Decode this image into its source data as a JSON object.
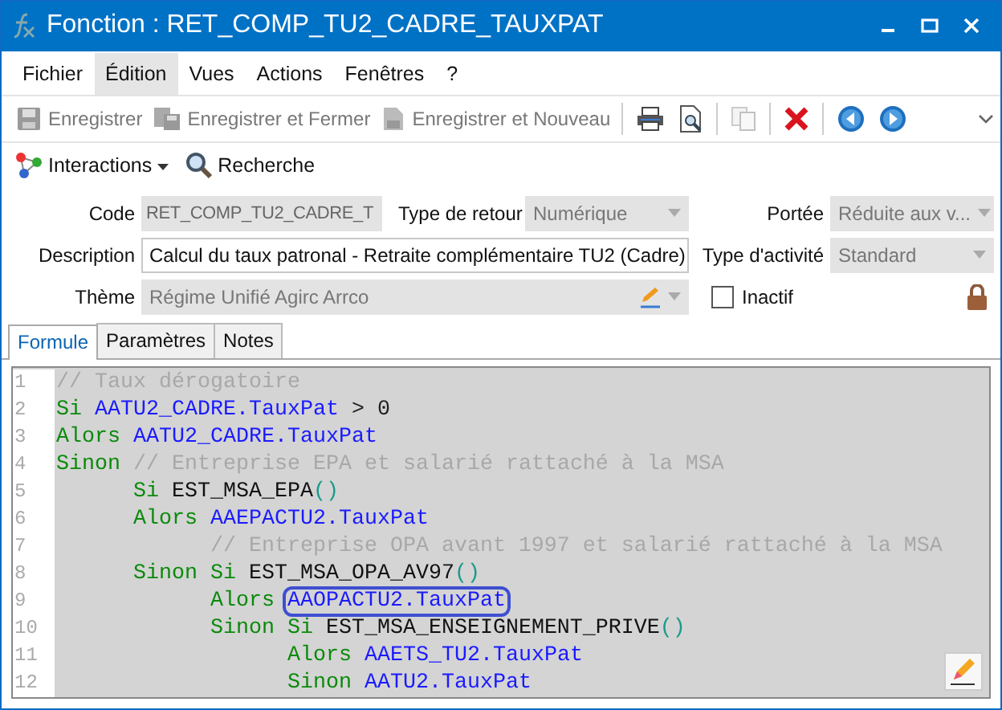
{
  "window": {
    "title": "Fonction : RET_COMP_TU2_CADRE_TAUXPAT"
  },
  "menu": [
    {
      "label": "Fichier",
      "selected": false
    },
    {
      "label": "Édition",
      "selected": true
    },
    {
      "label": "Vues",
      "selected": false
    },
    {
      "label": "Actions",
      "selected": false
    },
    {
      "label": "Fenêtres",
      "selected": false
    },
    {
      "label": "?",
      "selected": false
    }
  ],
  "toolbar": [
    {
      "kind": "text",
      "label": "Enregistrer",
      "disabled": true
    },
    {
      "kind": "text",
      "label": "Enregistrer et Fermer",
      "disabled": true
    },
    {
      "kind": "text",
      "label": "Enregistrer et Nouveau",
      "disabled": true
    },
    {
      "kind": "sep"
    },
    {
      "kind": "icon",
      "disabled": false
    },
    {
      "kind": "icon",
      "disabled": false
    },
    {
      "kind": "sep"
    },
    {
      "kind": "icon",
      "disabled": true
    },
    {
      "kind": "sep"
    },
    {
      "kind": "icon",
      "disabled": false
    },
    {
      "kind": "sep"
    },
    {
      "kind": "icon",
      "disabled": false
    },
    {
      "kind": "icon",
      "disabled": false
    }
  ],
  "actions": [
    {
      "kind": "menu",
      "label": "Interactions"
    },
    {
      "kind": "search",
      "label": "Recherche"
    }
  ],
  "form": {
    "code": {
      "label": "Code",
      "value": "RET_COMP_TU2_CADRE_T",
      "disabled": true
    },
    "return_type": {
      "label": "Type de retour",
      "value": "Numérique",
      "disabled": true
    },
    "scope": {
      "label": "Portée",
      "value": "Réduite aux v...",
      "disabled": true
    },
    "description": {
      "label": "Description",
      "value": "Calcul du taux patronal - Retraite complémentaire TU2 (Cadre)",
      "disabled": false
    },
    "activity_type": {
      "label": "Type d'activité",
      "value": "Standard",
      "disabled": true
    },
    "theme": {
      "label": "Thème",
      "value": "Régime Unifié Agirc Arrco",
      "disabled": true
    },
    "inactive": {
      "label": "Inactif",
      "checked": false
    }
  },
  "tabs": [
    {
      "label": "Formule",
      "selected": true
    },
    {
      "label": "Paramètres",
      "selected": false
    },
    {
      "label": "Notes",
      "selected": false
    }
  ],
  "code_lines": [
    {
      "number": "1",
      "tokens": [
        {
          "kind": "comment",
          "text": "// Taux dérogatoire"
        }
      ]
    },
    {
      "number": "2",
      "tokens": [
        {
          "kind": "keyword",
          "text": "Si "
        },
        {
          "kind": "ident",
          "text": "AATU2_CADRE.TauxPat"
        },
        {
          "kind": "op",
          "text": " > 0"
        }
      ]
    },
    {
      "number": "3",
      "tokens": [
        {
          "kind": "keyword",
          "text": "Alors "
        },
        {
          "kind": "ident",
          "text": "AATU2_CADRE.TauxPat"
        }
      ]
    },
    {
      "number": "4",
      "tokens": [
        {
          "kind": "keyword",
          "text": "Sinon "
        },
        {
          "kind": "comment",
          "text": "// Entreprise EPA et salarié rattaché à la MSA"
        }
      ]
    },
    {
      "number": "5",
      "tokens": [
        {
          "kind": "keyword",
          "text": "      Si "
        },
        {
          "kind": "func",
          "text": "EST_MSA_EPA"
        },
        {
          "kind": "paren",
          "text": "()"
        }
      ]
    },
    {
      "number": "6",
      "tokens": [
        {
          "kind": "keyword",
          "text": "      Alors "
        },
        {
          "kind": "ident",
          "text": "AAEPACTU2.TauxPat"
        }
      ]
    },
    {
      "number": "7",
      "tokens": [
        {
          "kind": "comment",
          "text": "            // Entreprise OPA avant 1997 et salarié rattaché à la MSA"
        }
      ]
    },
    {
      "number": "8",
      "tokens": [
        {
          "kind": "keyword",
          "text": "      Sinon Si "
        },
        {
          "kind": "func",
          "text": "EST_MSA_OPA_AV97"
        },
        {
          "kind": "paren",
          "text": "()"
        }
      ]
    },
    {
      "number": "9",
      "tokens": [
        {
          "kind": "keyword",
          "text": "            Alors "
        },
        {
          "kind": "ident",
          "text": "AAOPACTU2.TauxPat",
          "circled": true
        }
      ]
    },
    {
      "number": "10",
      "tokens": [
        {
          "kind": "keyword",
          "text": "            Sinon Si "
        },
        {
          "kind": "func",
          "text": "EST_MSA_ENSEIGNEMENT_PRIVE"
        },
        {
          "kind": "paren",
          "text": "()"
        }
      ]
    },
    {
      "number": "11",
      "tokens": [
        {
          "kind": "keyword",
          "text": "                  Alors "
        },
        {
          "kind": "ident",
          "text": "AAETS_TU2.TauxPat"
        }
      ]
    },
    {
      "number": "12",
      "tokens": [
        {
          "kind": "keyword",
          "text": "                  Sinon "
        },
        {
          "kind": "ident",
          "text": "AATU2.TauxPat"
        }
      ]
    }
  ]
}
